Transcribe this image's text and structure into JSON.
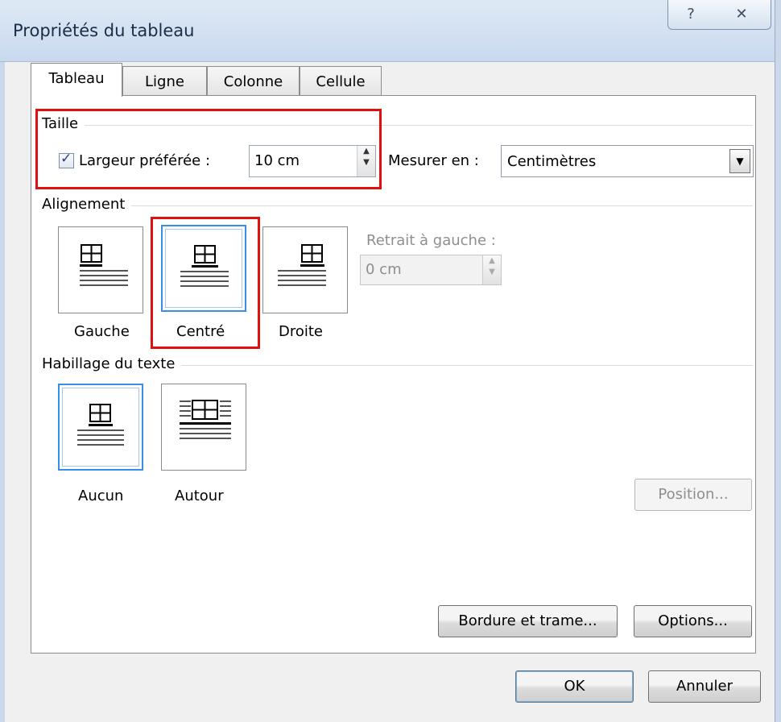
{
  "window": {
    "title": "Propriétés du tableau",
    "help_glyph": "?",
    "close_glyph": "✕"
  },
  "tabs": [
    {
      "label": "Tableau",
      "active": true
    },
    {
      "label": "Ligne",
      "active": false
    },
    {
      "label": "Colonne",
      "active": false
    },
    {
      "label": "Cellule",
      "active": false
    }
  ],
  "size_section": {
    "title": "Taille",
    "preferred_width": {
      "checked": true,
      "label": "Largeur préférée :",
      "value": "10 cm"
    },
    "measure_in": {
      "label": "Mesurer en :",
      "value": "Centimètres"
    }
  },
  "alignment_section": {
    "title": "Alignement",
    "options": [
      {
        "label": "Gauche",
        "selected": false
      },
      {
        "label": "Centré",
        "selected": true
      },
      {
        "label": "Droite",
        "selected": false
      }
    ],
    "left_indent": {
      "label": "Retrait à gauche :",
      "value": "0 cm",
      "disabled": true
    }
  },
  "wrapping_section": {
    "title": "Habillage du texte",
    "options": [
      {
        "label": "Aucun",
        "selected": true
      },
      {
        "label": "Autour",
        "selected": false
      }
    ],
    "position_button": "Position..."
  },
  "buttons": {
    "borders": "Bordure et trame...",
    "options": "Options...",
    "ok": "OK",
    "cancel": "Annuler"
  },
  "colors": {
    "highlight": "#e01010",
    "selection": "#3a8ee6",
    "disabled_text": "#8e8e8e"
  }
}
